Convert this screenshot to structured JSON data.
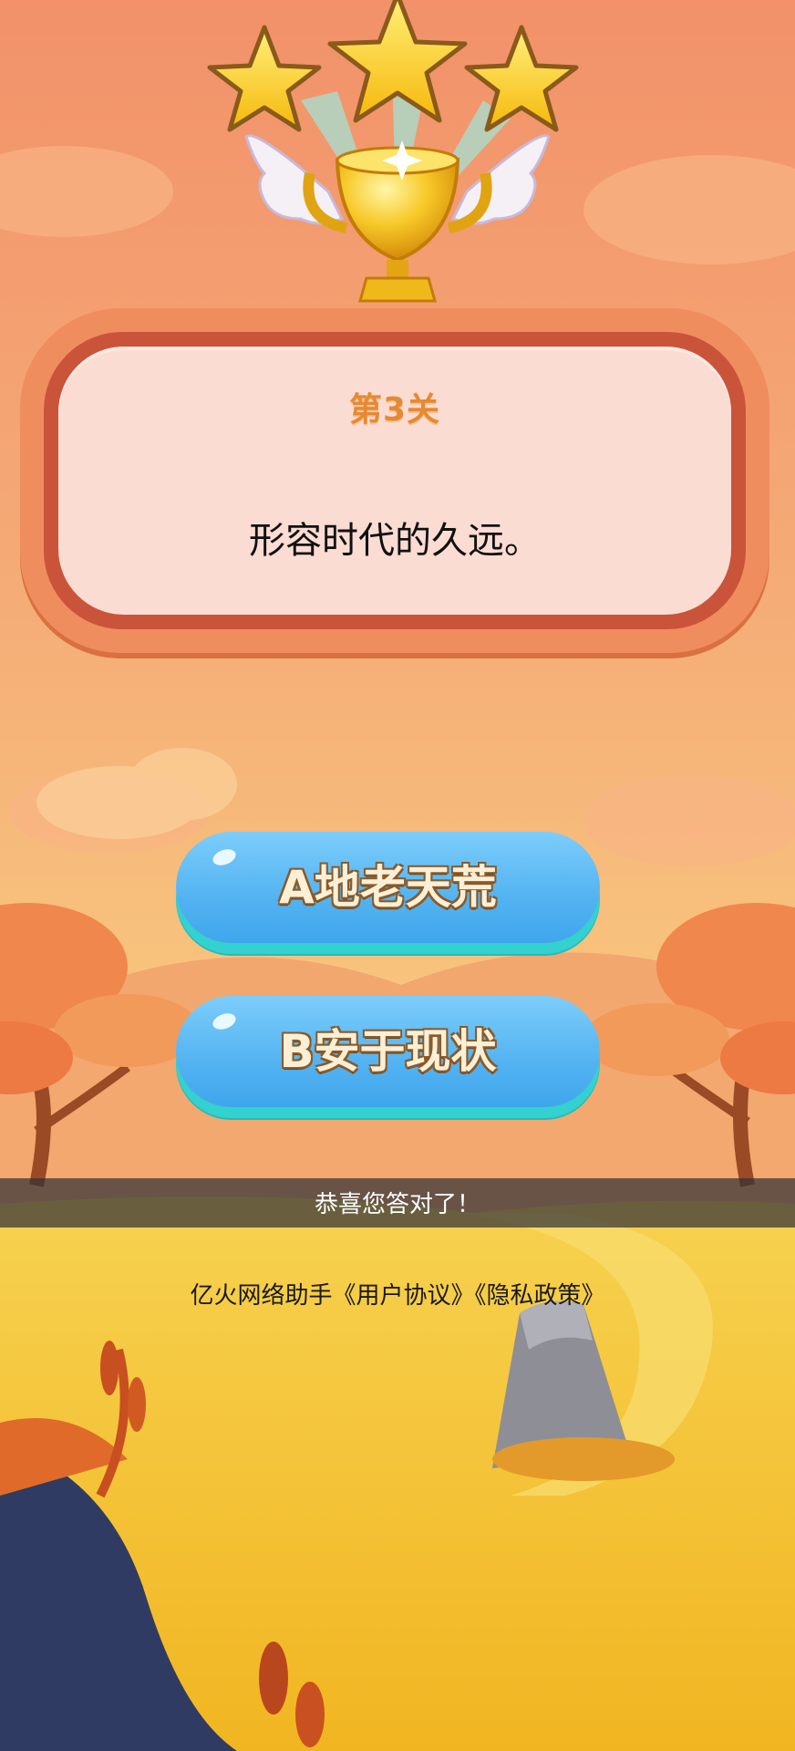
{
  "level": {
    "title": "第3关"
  },
  "question": {
    "text": "形容时代的久远。"
  },
  "answers": [
    {
      "label": "A地老天荒"
    },
    {
      "label": "B安于现状"
    }
  ],
  "toast": {
    "text": "恭喜您答对了！"
  },
  "footer": {
    "links_text": "亿火网络助手《用户协议》《隐私政策》"
  },
  "colors": {
    "sky_top": "#f49a6b",
    "sky_mid": "#f7c47e",
    "ground": "#f2bf2a",
    "card_border": "#c9543a",
    "card_fill": "#fbdcd2",
    "button_blue": "#53b3f1",
    "button_edge": "#33d1cf",
    "title_orange": "#e58a32"
  },
  "icons": [
    "star-icon",
    "trophy-icon",
    "wing-icon"
  ],
  "stars_earned": 3
}
